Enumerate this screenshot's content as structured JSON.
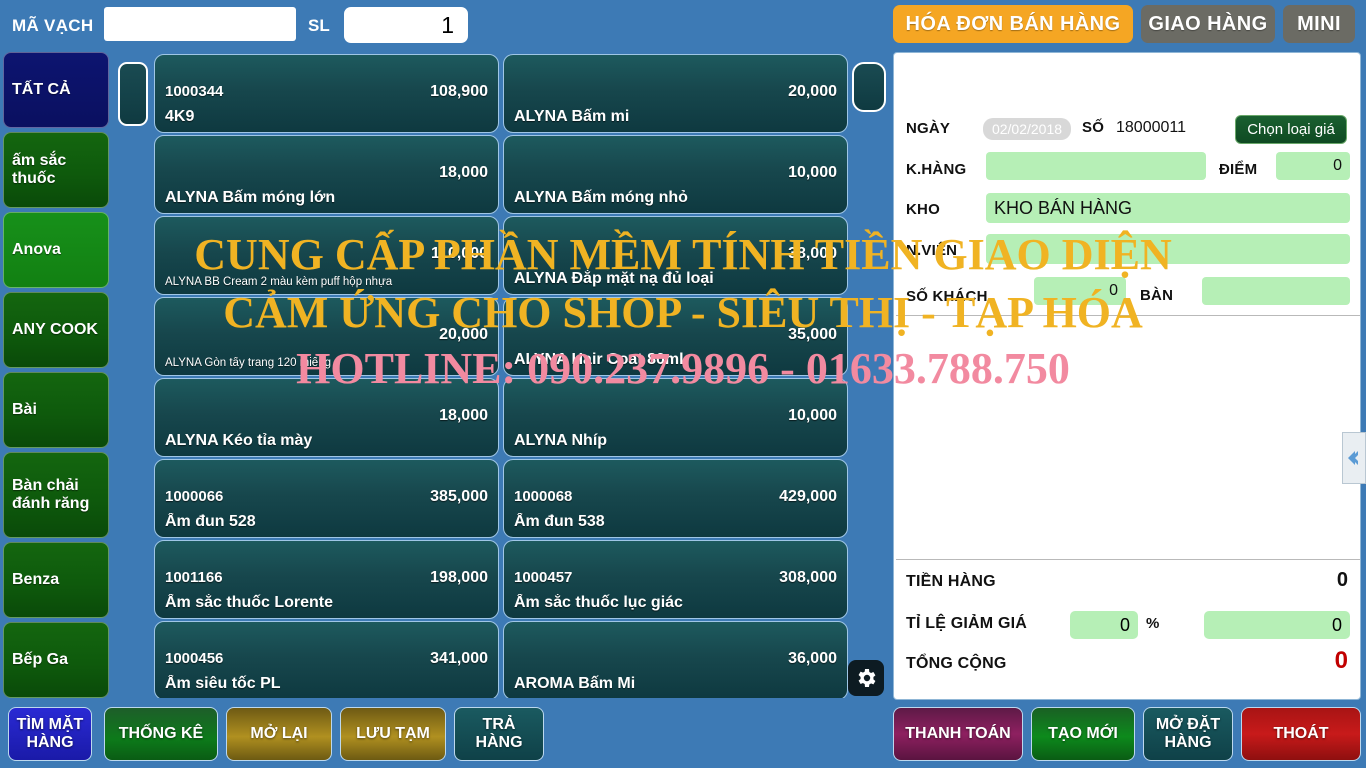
{
  "topbar": {
    "barcode_label": "MÃ VẠCH",
    "barcode_value": "",
    "barcode_placeholder": "",
    "qty_label": "SL",
    "qty_value": "1",
    "modes": [
      {
        "id": "invoice",
        "label": "HÓA ĐƠN BÁN HÀNG",
        "active": true,
        "color": "#f5a623"
      },
      {
        "id": "delivery",
        "label": "GIAO HÀNG",
        "active": false,
        "color": "#6b6b64"
      },
      {
        "id": "mini",
        "label": "MINI",
        "active": false,
        "color": "#6b6b64"
      }
    ]
  },
  "sidebar": {
    "items": [
      {
        "label": "TẤT CẢ",
        "state": "selected"
      },
      {
        "label": "ấm sắc thuốc",
        "state": "normal"
      },
      {
        "label": "Anova",
        "state": "bright"
      },
      {
        "label": "ANY COOK",
        "state": "normal"
      },
      {
        "label": "Bài",
        "state": "normal"
      },
      {
        "label": "Bàn chải đánh răng",
        "state": "normal"
      },
      {
        "label": "Benza",
        "state": "normal"
      },
      {
        "label": "Bếp Ga",
        "state": "normal"
      }
    ]
  },
  "grid": {
    "scroll_up_left_icon": "scroll-up-button",
    "scroll_up_right_icon": "scroll-up-button",
    "gear_icon": "gear-icon",
    "products": [
      {
        "code": "1000344",
        "price": "108,900",
        "name": "4K9",
        "small": false
      },
      {
        "code": "",
        "price": "20,000",
        "name": "ALYNA Bấm mi",
        "small": false
      },
      {
        "code": "",
        "price": "18,000",
        "name": "ALYNA Bấm móng lớn",
        "small": false
      },
      {
        "code": "",
        "price": "10,000",
        "name": "ALYNA Bấm móng nhỏ",
        "small": false
      },
      {
        "code": "",
        "price": "110,000",
        "name": "ALYNA BB Cream 2 màu kèm puff hộp nhựa",
        "small": true
      },
      {
        "code": "",
        "price": "38,000",
        "name": "ALYNA Đắp mặt nạ đủ loại",
        "small": false
      },
      {
        "code": "",
        "price": "20,000",
        "name": "ALYNA Gòn tẩy trang 120 miếng",
        "small": true
      },
      {
        "code": "",
        "price": "35,000",
        "name": "ALYNA Hair Coat 80ml",
        "small": false
      },
      {
        "code": "",
        "price": "18,000",
        "name": "ALYNA Kéo tỉa mày",
        "small": false
      },
      {
        "code": "",
        "price": "10,000",
        "name": "ALYNA Nhíp",
        "small": false
      },
      {
        "code": "1000066",
        "price": "385,000",
        "name": "Ấm đun 528",
        "small": false
      },
      {
        "code": "1000068",
        "price": "429,000",
        "name": "Ấm đun 538",
        "small": false
      },
      {
        "code": "1001166",
        "price": "198,000",
        "name": "Ấm sắc thuốc Lorente",
        "small": false
      },
      {
        "code": "1000457",
        "price": "308,000",
        "name": "Ấm sắc thuốc lục giác",
        "small": false
      },
      {
        "code": "1000456",
        "price": "341,000",
        "name": "Ấm siêu tốc PL",
        "small": false
      },
      {
        "code": "",
        "price": "36,000",
        "name": "AROMA Bấm Mi",
        "small": false
      }
    ]
  },
  "panel": {
    "date_label": "NGÀY",
    "date_value": "02/02/2018",
    "number_label": "SỐ",
    "number_value": "18000011",
    "price_type_button": "Chọn loại giá",
    "customer_label": "K.HÀNG",
    "customer_value": "",
    "points_label": "ĐIỂM",
    "points_value": "0",
    "warehouse_label": "KHO",
    "warehouse_value": "KHO BÁN HÀNG",
    "staff_label": "N.VIÊN",
    "staff_value": "",
    "guests_label": "SỐ KHÁCH",
    "guests_value": "0",
    "table_label": "BÀN",
    "table_value": ""
  },
  "totals": {
    "subtotal_label": "TIỀN HÀNG",
    "subtotal_value": "0",
    "discount_label": "TỈ LỆ GIẢM GIÁ",
    "discount_pct": "0",
    "percent_sign": "%",
    "discount_amount": "0",
    "grand_label": "TỔNG CỘNG",
    "grand_value": "0",
    "grand_color": "#c10000"
  },
  "collapse_handle": {
    "icon": "chevron-left-icon"
  },
  "bottom_left_buttons": [
    {
      "id": "find",
      "label": "TÌM MẶT HÀNG"
    },
    {
      "id": "stats",
      "label": "THỐNG KÊ"
    },
    {
      "id": "reopen",
      "label": "MỞ LẠI"
    },
    {
      "id": "hold",
      "label": "LƯU TẠM"
    },
    {
      "id": "return",
      "label": "TRẢ HÀNG"
    }
  ],
  "bottom_right_buttons": [
    {
      "id": "pay",
      "label": "THANH TOÁN"
    },
    {
      "id": "new",
      "label": "TẠO MỚI"
    },
    {
      "id": "order",
      "label": "MỞ ĐẶT HÀNG"
    },
    {
      "id": "exit",
      "label": "THOÁT"
    }
  ],
  "watermark": {
    "line1": "CUNG CẤP PHẦN MỀM TÍNH TIỀN GIAO DIỆN",
    "line2": "CẢM ỨNG CHO SHOP - SIÊU THỊ - TẠP HÓA",
    "line3": "HOTLINE: 090.237.9896 - 01633.788.750",
    "color_gold": "#f0b323",
    "color_pink": "#f28aa0"
  }
}
